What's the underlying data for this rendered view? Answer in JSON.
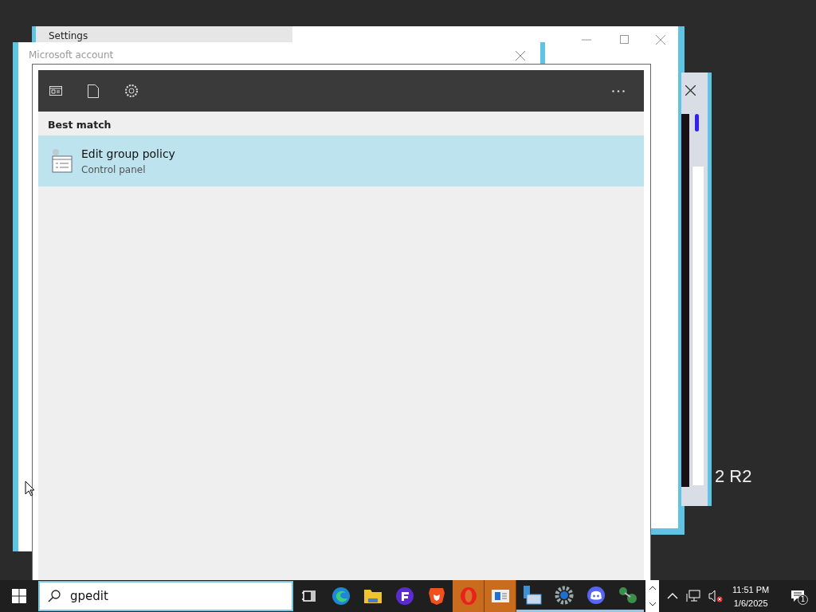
{
  "windows": [
    {
      "title": "Settings"
    },
    {
      "title": "Microsoft account"
    }
  ],
  "desktop_text": "2 R2",
  "search_panel": {
    "best_match_heading": "Best match",
    "results": [
      {
        "title": "Edit group policy",
        "subtitle": "Control panel",
        "selected": true
      }
    ]
  },
  "taskbar": {
    "search": {
      "value": "gpedit"
    },
    "apps": [
      {
        "kind": "taskview",
        "active": false,
        "running": false
      },
      {
        "kind": "edge",
        "active": false,
        "running": false
      },
      {
        "kind": "folder",
        "active": false,
        "running": false
      },
      {
        "kind": "purple",
        "active": false,
        "running": false
      },
      {
        "kind": "lion",
        "active": false,
        "running": false
      },
      {
        "kind": "opera",
        "active": true,
        "running": false
      },
      {
        "kind": "card",
        "active": true,
        "running": false
      },
      {
        "kind": "server",
        "active": false,
        "running": true
      },
      {
        "kind": "gear",
        "active": false,
        "running": true
      },
      {
        "kind": "chat",
        "active": false,
        "running": true
      },
      {
        "kind": "link",
        "active": false,
        "running": true
      }
    ],
    "time": "11:51 PM",
    "date": "1/6/2025",
    "notifications": "1"
  }
}
